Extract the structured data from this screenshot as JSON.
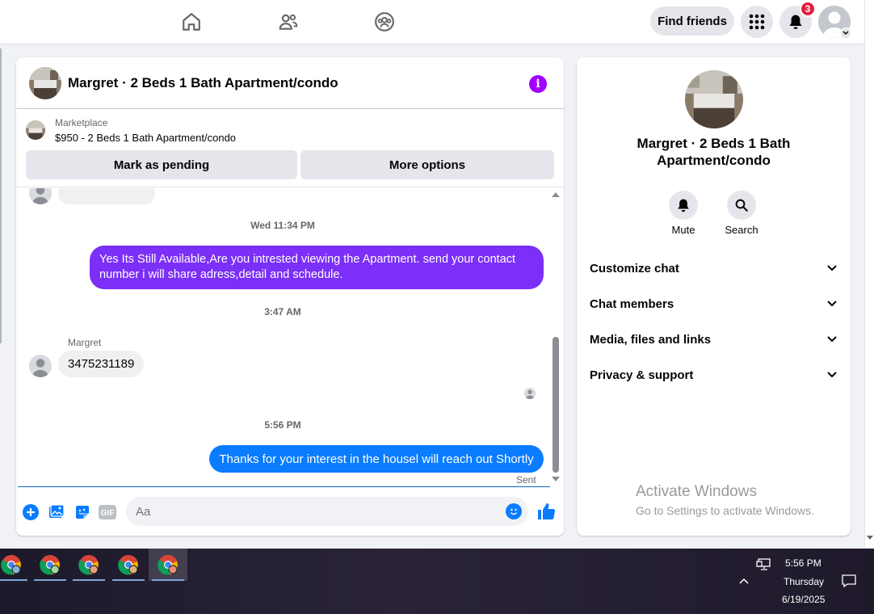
{
  "nav": {
    "find_friends_label": "Find friends",
    "notification_count": "3"
  },
  "chat": {
    "title": "Margret · 2 Beds 1 Bath Apartment/condo",
    "marketplace_label": "Marketplace",
    "listing_text": "$950 - 2 Beds 1 Bath Apartment/condo",
    "mark_pending_label": "Mark as pending",
    "more_options_label": "More options",
    "messages": [
      {
        "timestamp": "Wed 11:34 PM"
      },
      {
        "text": "Yes Its Still Available,Are you intrested viewing the Apartment. send your contact number i will share adress,detail and schedule.",
        "direction": "outgoing"
      },
      {
        "timestamp": "3:47 AM"
      },
      {
        "sender": "Margret",
        "text": "3475231189",
        "direction": "incoming"
      },
      {
        "timestamp": "5:56 PM"
      },
      {
        "text": "Thanks for your interest in the housel will reach out Shortly",
        "direction": "outgoing",
        "status": "Sent"
      }
    ],
    "composer_placeholder": "Aa"
  },
  "info_panel": {
    "title": "Margret · 2 Beds 1 Bath Apartment/condo",
    "mute_label": "Mute",
    "search_label": "Search",
    "sections": [
      "Customize chat",
      "Chat members",
      "Media, files and links",
      "Privacy & support"
    ]
  },
  "watermark": {
    "line1": "Activate Windows",
    "line2": "Go to Settings to activate Windows."
  },
  "taskbar": {
    "time": "5:56 PM",
    "day": "Thursday",
    "date": "6/19/2025"
  },
  "colors": {
    "accent_blue": "#0a7cff",
    "purple_bubble": "#7b2ff7",
    "badge_red": "#e41e3f",
    "info_purple": "#a200ff"
  }
}
